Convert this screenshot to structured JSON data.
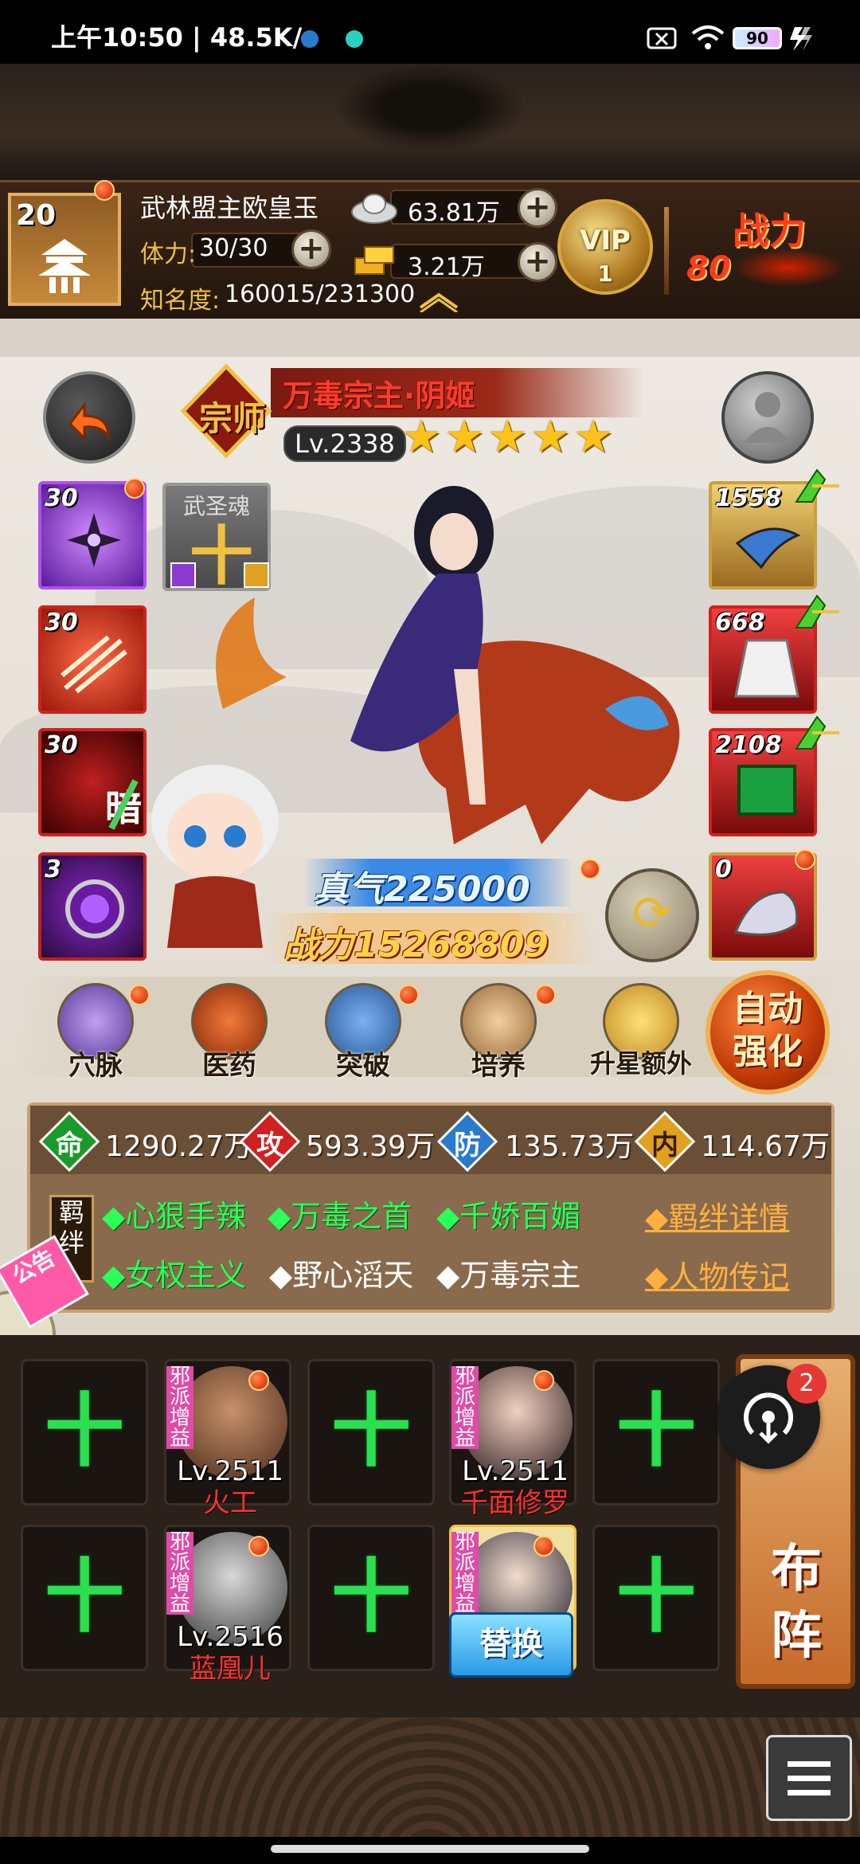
{
  "status_bar": {
    "time_speed": "上午10:50 | 48.5K/s",
    "battery": "90"
  },
  "player": {
    "level": "20",
    "name": "武林盟主欧皇玉",
    "stamina_label": "体力:",
    "stamina_value": "30/30",
    "fame_label": "知名度:",
    "fame_value": "160015/231300",
    "silver": "63.81万",
    "gold": "3.21万",
    "vip_label": "VIP",
    "vip_level": "1",
    "power_label": "战力",
    "power_partial": "80"
  },
  "hero": {
    "badge": "宗师",
    "name": "万毒宗主·阴姬",
    "level": "Lv.2338",
    "stars": 5,
    "qi": "真气225000",
    "power": "战力15268809"
  },
  "left_slots": [
    {
      "num": "30"
    },
    {
      "num": "",
      "title": "武圣魂",
      "glyph": "十"
    },
    {
      "num": "30"
    },
    {
      "num": "30",
      "glyph": "暗"
    },
    {
      "num": "3"
    }
  ],
  "right_slots": [
    {
      "num": "1558"
    },
    {
      "num": "668"
    },
    {
      "num": "2108"
    },
    {
      "num": "0"
    }
  ],
  "functions": [
    {
      "label": "穴脉"
    },
    {
      "label": "医药"
    },
    {
      "label": "突破"
    },
    {
      "label": "培养"
    },
    {
      "label": "升星额外"
    }
  ],
  "auto_strengthen": "自动强化",
  "stats": {
    "hp_label": "命",
    "hp": "1290.27万",
    "atk_label": "攻",
    "atk": "593.39万",
    "def_label": "防",
    "def": "135.73万",
    "inner_label": "内",
    "inner": "114.67万"
  },
  "bond_tag": "羁绊",
  "traits_row1": [
    "◆心狠手辣",
    "◆万毒之首",
    "◆千娇百媚"
  ],
  "traits_row2_green": "◆女权主义",
  "traits_row2_white": [
    "◆野心滔天",
    "◆万毒宗主"
  ],
  "links": {
    "bond_detail": "◆羁绊详情",
    "biography": "◆人物传记"
  },
  "notice": "公告",
  "lineup": {
    "role_tag": "邪派增益",
    "plus": "十",
    "heroes": [
      {
        "level": "Lv.2511",
        "name": "火工"
      },
      {
        "level": "Lv.2511",
        "name": "千面修罗"
      },
      {
        "level": "Lv.2516",
        "name": "蓝凰儿"
      }
    ],
    "swap": "替换",
    "formation": "布阵"
  },
  "float_badge": "2",
  "colors": {
    "accent_red": "#ff3b2a",
    "green": "#2ae050",
    "gold": "#ffc21a"
  }
}
